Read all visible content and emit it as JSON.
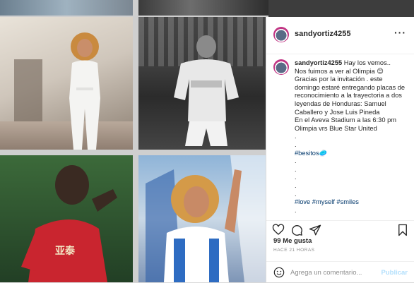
{
  "post": {
    "username": "sandyortiz4255",
    "caption_lines": [
      "Hay los vemos..",
      "Nos fuimos a ver al Olimpia 😊",
      "Gracias por la invitación . este",
      "domingo estaré entregando placas de",
      "reconocimiento a la trayectoria a dos",
      "leyendas de Honduras: Samuel",
      "Caballero y Jose Luis Pineda",
      "En el Aveva Stadium a las 6:30 pm",
      "Olimpia vrs Blue Star United",
      ".",
      ".",
      "#besitos🥏",
      ".",
      ".",
      ".",
      ".",
      ".",
      "#love #myself #smiles",
      "."
    ],
    "likes": "99 Me gusta",
    "time_ago": "HACE 21 HORAS"
  },
  "comment": {
    "placeholder": "Agrega un comentario...",
    "publish_label": "Publicar"
  },
  "icons": {
    "more": "more-options-icon",
    "like": "heart-icon",
    "comment": "comment-icon",
    "share": "share-icon",
    "save": "bookmark-icon",
    "emoji": "emoji-icon"
  }
}
